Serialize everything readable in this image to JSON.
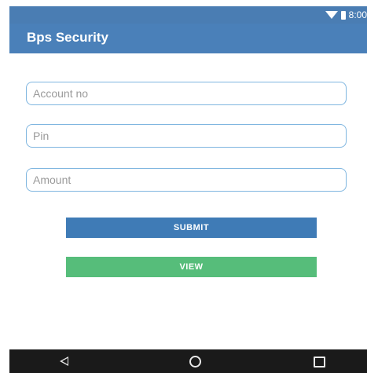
{
  "status_bar": {
    "time": "8:00",
    "icons": [
      "wifi-icon",
      "battery-icon"
    ]
  },
  "app_bar": {
    "title": "Bps Security"
  },
  "form": {
    "account_placeholder": "Account no",
    "account_value": "",
    "pin_placeholder": "Pin",
    "pin_value": "",
    "amount_placeholder": "Amount",
    "amount_value": ""
  },
  "buttons": {
    "submit_label": "SUBMIT",
    "view_label": "VIEW"
  },
  "nav_bar": {
    "icons": [
      "back-icon",
      "home-icon",
      "recent-apps-icon"
    ]
  },
  "colors": {
    "app_bar": "#4a80b9",
    "submit": "#3f7bb6",
    "view": "#56bd7a",
    "field_border": "#7fb6e0"
  }
}
